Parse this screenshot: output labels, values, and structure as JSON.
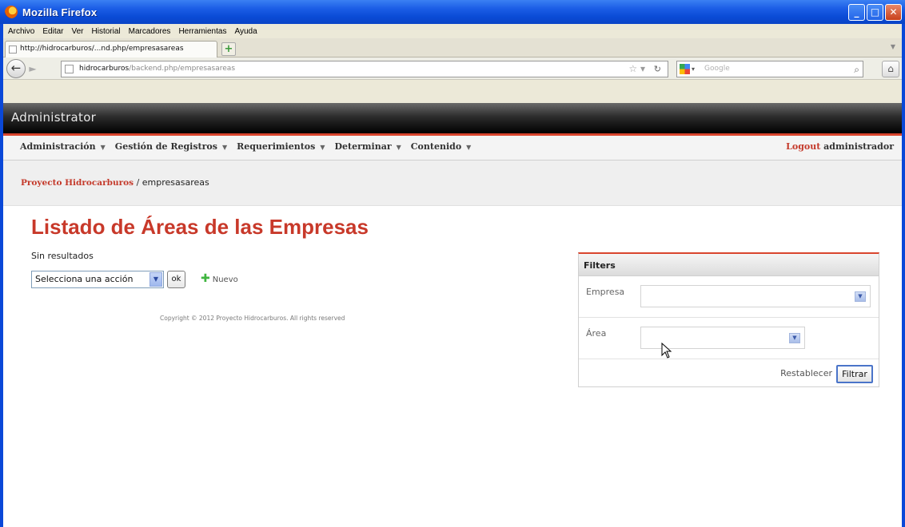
{
  "window": {
    "title": "Mozilla Firefox"
  },
  "menubar": [
    "Archivo",
    "Editar",
    "Ver",
    "Historial",
    "Marcadores",
    "Herramientas",
    "Ayuda"
  ],
  "tab": {
    "title": "http://hidrocarburos/...nd.php/empresasareas"
  },
  "navbar": {
    "url_host": "hidrocarburos",
    "url_path": "/backend.php/empresasareas",
    "search_placeholder": "Google"
  },
  "admin": {
    "title": "Administrator"
  },
  "nav": {
    "items": [
      "Administración",
      "Gestión de Registros",
      "Requerimientos",
      "Determinar",
      "Contenido"
    ],
    "logout_label": "Logout",
    "user": "administrador"
  },
  "breadcrumb": {
    "root": "Proyecto Hidrocarburos",
    "separator": "/",
    "current": "empresasareas"
  },
  "main": {
    "title": "Listado de Áreas de las Empresas",
    "no_results": "Sin resultados",
    "action_select": "Selecciona una acción",
    "ok_label": "ok",
    "new_label": "Nuevo",
    "footer": "Copyright © 2012 Proyecto Hidrocarburos. All rights reserved"
  },
  "filters": {
    "header": "Filters",
    "fields": [
      {
        "label": "Empresa",
        "value": ""
      },
      {
        "label": "Área",
        "value": ""
      }
    ],
    "reset_label": "Restablecer",
    "submit_label": "Filtrar"
  },
  "colors": {
    "accent": "#c8392a",
    "titlebar": "#0a4bd6",
    "admin_bar": "#000000"
  }
}
